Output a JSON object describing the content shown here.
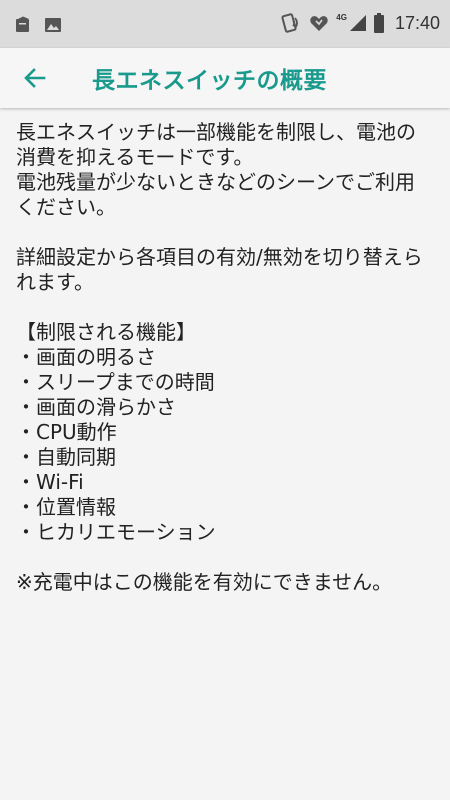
{
  "status_bar": {
    "time": "17:40",
    "network": "4G",
    "icons": [
      "notification-icon",
      "image-icon",
      "nfc-icon",
      "heart-sync-icon",
      "signal-icon",
      "battery-icon"
    ]
  },
  "app_bar": {
    "back_icon": "arrow-left-icon",
    "title": "長エネスイッチの概要",
    "title_color": "#199a8c"
  },
  "content": {
    "para1": "長エネスイッチは一部機能を制限し、電池の消費を抑えるモードです。",
    "para2": "電池残量が少ないときなどのシーンでご利用ください。",
    "para3": "詳細設定から各項目の有効/無効を切り替えられます。",
    "list_heading": "【制限される機能】",
    "features": [
      "・画面の明るさ",
      "・スリープまでの時間",
      "・画面の滑らかさ",
      "・CPU動作",
      "・自動同期",
      "・Wi-Fi",
      "・位置情報",
      "・ヒカリエモーション"
    ],
    "note": "※充電中はこの機能を有効にできません。"
  }
}
